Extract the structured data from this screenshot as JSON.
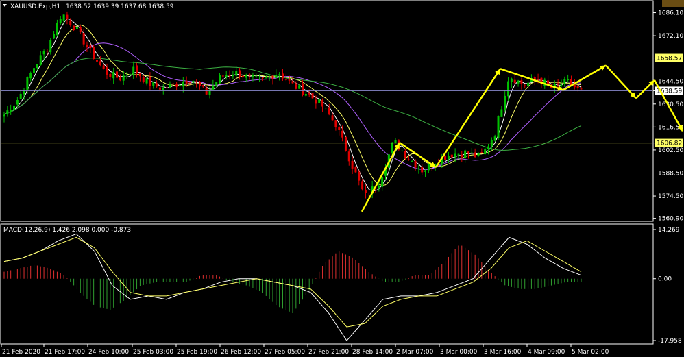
{
  "chart_header": {
    "symbol": "XAUUSD.Exp,H1",
    "ohlc": "1638.52 1639.39 1637.68 1638.59",
    "macd_label": "MACD(12,26,9) 1.426 2.098 0.000 -0.873"
  },
  "colors": {
    "background": "#000000",
    "bull_candle": "#00c000",
    "bear_candle": "#e00000",
    "level_line": "#ffff66",
    "bid_line": "#8888cc",
    "fast_ma": "#ffffff",
    "mid_ma": "#ffff66",
    "slow_ma_purple": "#b060ff",
    "slow_ma_green": "#3cb043",
    "arrow": "#ffff00",
    "macd_pos": "#e03030",
    "macd_neg": "#30a030",
    "macd_line": "#ffffff",
    "signal_line": "#ffff66"
  },
  "chart_data": [
    {
      "type": "candlestick",
      "title": "XAUUSD.Exp,H1",
      "y_ticks": [
        "1686.10",
        "1672.10",
        "1658.57",
        "1644.50",
        "1638.59",
        "1630.50",
        "1616.50",
        "1606.82",
        "1602.50",
        "1588.50",
        "1574.50",
        "1560.90"
      ],
      "ylim": [
        1559.5,
        1693
      ],
      "level_lines": [
        {
          "label": "1658.57",
          "value": 1658.57
        },
        {
          "label": "1606.82",
          "value": 1606.82
        }
      ],
      "bid_line": {
        "label": "1638.59",
        "value": 1638.59
      },
      "x_ticks": [
        "21 Feb 2020",
        "21 Feb 17:00",
        "24 Feb 10:00",
        "25 Feb 03:00",
        "25 Feb 19:00",
        "26 Feb 12:00",
        "27 Feb 05:00",
        "27 Feb 21:00",
        "28 Feb 14:00",
        "2 Mar 07:00",
        "3 Mar 00:00",
        "3 Mar 16:00",
        "4 Mar 09:00",
        "5 Mar 02:00"
      ],
      "price_path": [
        1624,
        1634,
        1652,
        1665,
        1686,
        1676,
        1662,
        1650,
        1646,
        1652,
        1643,
        1640,
        1643,
        1646,
        1637,
        1647,
        1650,
        1646,
        1645,
        1650,
        1642,
        1637,
        1630,
        1618,
        1596,
        1574,
        1583,
        1608,
        1598,
        1590,
        1596,
        1600,
        1601,
        1598,
        1612,
        1648,
        1642,
        1646,
        1640,
        1644,
        1638
      ],
      "projection_arrows": [
        {
          "from": [
            1565
          ],
          "to": [
            1607
          ]
        },
        {
          "from": [
            1607
          ],
          "to": [
            1592
          ]
        },
        {
          "from": [
            1592
          ],
          "to": [
            1652
          ]
        },
        {
          "from": [
            1652
          ],
          "to": [
            1639
          ]
        },
        {
          "from": [
            1639
          ],
          "to": [
            1654
          ]
        },
        {
          "from": [
            1654
          ],
          "to": [
            1634
          ]
        },
        {
          "from": [
            1634
          ],
          "to": [
            1645
          ]
        },
        {
          "from": [
            1645
          ],
          "to": [
            1614
          ]
        }
      ]
    },
    {
      "type": "bar",
      "title": "MACD(12,26,9) 1.426 2.098 0.000 -0.873",
      "y_ticks": [
        "14.269",
        "0.00",
        "-17.958"
      ],
      "ylim": [
        -17.958,
        14.269
      ],
      "histogram": [
        2,
        3,
        4,
        3,
        1,
        -4,
        -8,
        -9,
        -6,
        -2,
        -1,
        -1,
        -1,
        1,
        1,
        -1,
        -2,
        -4,
        -8,
        -10,
        -4,
        4,
        8,
        6,
        2,
        -1,
        -1,
        1,
        1,
        5,
        10,
        7,
        2,
        -2,
        -3,
        -3,
        -2,
        -1,
        -1
      ],
      "macd_line": [
        5,
        6,
        8,
        11,
        13,
        8,
        -2,
        -6,
        -5,
        -6,
        -4,
        -3,
        -1,
        0,
        0,
        -1,
        -2,
        -4,
        -10,
        -18,
        -12,
        -6,
        -5,
        -5,
        -4,
        -2,
        0,
        6,
        12,
        10,
        6,
        3,
        1
      ],
      "signal_line": [
        5,
        6,
        8,
        10,
        12,
        9,
        2,
        -4,
        -5,
        -5,
        -4,
        -3,
        -2,
        -1,
        0,
        -1,
        -2,
        -3,
        -8,
        -14,
        -13,
        -8,
        -6,
        -5,
        -5,
        -3,
        -1,
        3,
        9,
        11,
        8,
        5,
        2
      ]
    }
  ]
}
